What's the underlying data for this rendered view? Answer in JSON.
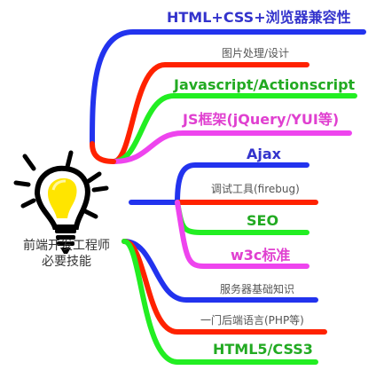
{
  "center": {
    "title_line1": "前端开发工程师",
    "title_line2": "必要技能"
  },
  "skills": [
    {
      "label": "HTML+CSS+浏览器兼容性",
      "color": "#3333cc"
    },
    {
      "label": "图片处理/设计",
      "color": "#555555"
    },
    {
      "label": "Javascript/Actionscript",
      "color": "#22aa22"
    },
    {
      "label": "JS框架(jQuery/YUI等)",
      "color": "#e040d0"
    },
    {
      "label": "Ajax",
      "color": "#3333cc"
    },
    {
      "label": "调试工具(firebug)",
      "color": "#555555"
    },
    {
      "label": "SEO",
      "color": "#22aa22"
    },
    {
      "label": "w3c标准",
      "color": "#e040d0"
    },
    {
      "label": "服务器基础知识",
      "color": "#555555"
    },
    {
      "label": "一门后端语言(PHP等)",
      "color": "#555555"
    },
    {
      "label": "HTML5/CSS3",
      "color": "#22aa22"
    }
  ],
  "branch_colors": {
    "blue": "#2233ee",
    "red": "#ff2200",
    "green": "#22ee22",
    "magenta": "#ee44ee"
  },
  "icon": "lightbulb-icon"
}
